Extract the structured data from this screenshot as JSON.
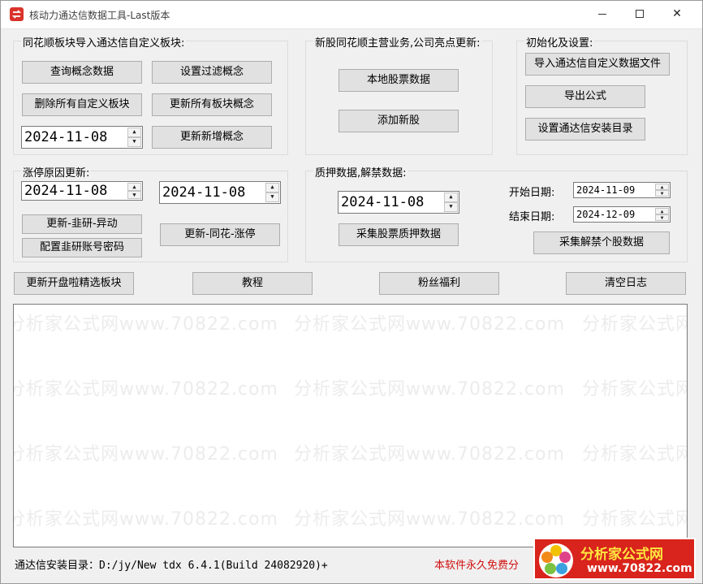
{
  "window": {
    "title": "核动力通达信数据工具-Last版本",
    "minimize": "minimize",
    "maximize": "maximize",
    "close": "✕"
  },
  "groups": {
    "import": {
      "title": "同花顺板块导入通达信自定义板块:",
      "query_concepts": "查询概念数据",
      "set_filter": "设置过滤概念",
      "delete_custom": "删除所有自定义板块",
      "update_all_concepts": "更新所有板块概念",
      "update_new_concepts": "更新新增概念",
      "date": "2024-11-08"
    },
    "new_stock": {
      "title": "新股同花顺主营业务,公司亮点更新:",
      "local_stock": "本地股票数据",
      "add_new": "添加新股"
    },
    "init": {
      "title": "初始化及设置:",
      "import_file": "导入通达信自定义数据文件",
      "export_formula": "导出公式",
      "set_dir": "设置通达信安装目录"
    },
    "limit_up": {
      "title": "涨停原因更新:",
      "date_left": "2024-11-08",
      "date_right": "2024-11-08",
      "update_jiuyan": "更新-韭研-异动",
      "config_jiuyan": "配置韭研账号密码",
      "update_ths": "更新-同花-涨停"
    },
    "pledge": {
      "title": "质押数据,解禁数据:",
      "date": "2024-11-08",
      "collect_pledge": "采集股票质押数据",
      "start_label": "开始日期:",
      "start_date": "2024-11-09",
      "end_label": "结束日期:",
      "end_date": "2024-12-09",
      "collect_unlock": "采集解禁个股数据"
    }
  },
  "bottom_buttons": {
    "update_kaipanla": "更新开盘啦精选板块",
    "tutorial": "教程",
    "fans": "粉丝福利",
    "clear_log": "清空日志"
  },
  "watermark": "分析家公式网www.70822.com",
  "status": {
    "install_dir": "通达信安装目录：D:/jy/New tdx 6.4.1(Build 24082920)+",
    "free_notice": "本软件永久免费分"
  },
  "logo": {
    "name": "分析家公式网",
    "url": "www.70822.com"
  },
  "colors": {
    "accent_red": "#d01010",
    "logo_bg": "#d8241c",
    "logo_text": "#ffe640"
  }
}
